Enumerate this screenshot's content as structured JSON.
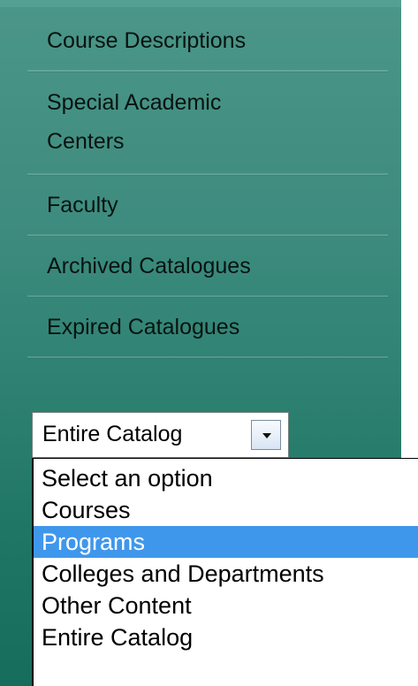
{
  "sidebar": {
    "items": [
      {
        "label": "Course Descriptions",
        "type": "single"
      },
      {
        "label_lines": [
          "Special Academic",
          "Centers"
        ],
        "type": "double"
      },
      {
        "label": "Faculty",
        "type": "single"
      },
      {
        "label": "Archived Catalogues",
        "type": "single"
      },
      {
        "label": "Expired Catalogues",
        "type": "single"
      }
    ]
  },
  "search_scope": {
    "selected_value": "Entire Catalog",
    "arrow_icon": "chevron-down-icon",
    "options": [
      {
        "label": "Select an option",
        "highlighted": false
      },
      {
        "label": "Courses",
        "highlighted": false
      },
      {
        "label": "Programs",
        "highlighted": true
      },
      {
        "label": "Colleges and Departments",
        "highlighted": false
      },
      {
        "label": "Other Content",
        "highlighted": false
      },
      {
        "label": "Entire Catalog",
        "highlighted": false
      }
    ]
  },
  "colors": {
    "sidebar_top": "#4b9688",
    "sidebar_bottom": "#166d5b",
    "highlight": "#3f97ec",
    "text_dark": "#081311"
  }
}
